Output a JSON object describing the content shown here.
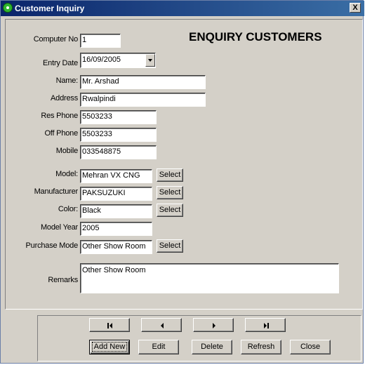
{
  "window": {
    "title": "Customer Inquiry",
    "close_label": "X"
  },
  "heading": "ENQUIRY CUSTOMERS",
  "fields": {
    "computer_no": {
      "label": "Computer No",
      "value": "1"
    },
    "entry_date": {
      "label": "Entry Date",
      "value": "16/09/2005"
    },
    "name": {
      "label": "Name:",
      "value": "Mr. Arshad"
    },
    "address": {
      "label": "Address",
      "value": "Rwalpindi"
    },
    "res_phone": {
      "label": "Res Phone",
      "value": "5503233"
    },
    "off_phone": {
      "label": "Off Phone",
      "value": "5503233"
    },
    "mobile": {
      "label": "Mobile",
      "value": "033548875"
    },
    "model": {
      "label": "Model:",
      "value": "Mehran VX CNG"
    },
    "manufacturer": {
      "label": "Manufacturer",
      "value": "PAKSUZUKI"
    },
    "color": {
      "label": "Color:",
      "value": "Black"
    },
    "model_year": {
      "label": "Model Year",
      "value": "2005"
    },
    "purchase_mode": {
      "label": "Purchase Mode",
      "value": "Other Show Room"
    },
    "remarks": {
      "label": "Remarks",
      "value": "Other Show Room"
    }
  },
  "select_label": "Select",
  "actions": {
    "add_new": "Add New",
    "edit": "Edit",
    "delete": "Delete",
    "refresh": "Refresh",
    "close": "Close"
  },
  "nav_icons": [
    "first-record-icon",
    "previous-record-icon",
    "next-record-icon",
    "last-record-icon"
  ]
}
